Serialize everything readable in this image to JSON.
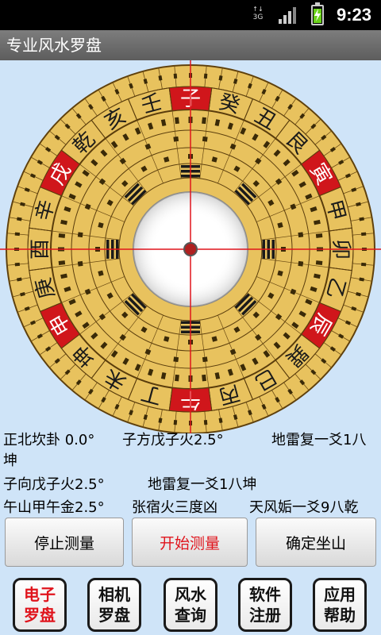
{
  "status_bar": {
    "time": "9:23",
    "network_label": "3G",
    "battery_color": "#6ad11a"
  },
  "app_title": "专业风水罗盘",
  "compass": {
    "ring_outer_labels": [
      "子",
      "癸",
      "丑",
      "艮",
      "寅",
      "甲",
      "卯",
      "乙",
      "辰",
      "巽",
      "巳",
      "丙",
      "午",
      "丁",
      "未",
      "坤",
      "申",
      "庚",
      "酉",
      "辛",
      "戌",
      "乾",
      "亥",
      "壬"
    ],
    "center_color": "#ffffff",
    "face_color": "#e8c25e",
    "red_accent": "#d0161b"
  },
  "readings": {
    "line1_a": "正北坎卦  0.0°",
    "line1_b": "子方戊子火2.5°",
    "line1_c": "地雷复一爻1八",
    "line1_wrap": "坤",
    "line2_a": "子向戊子火2.5°",
    "line2_b": "地雷复一爻1八坤",
    "line3_a": "午山甲午金2.5°",
    "line3_b": "张宿火三度凶",
    "line3_c": "天风姤一爻9八乾"
  },
  "buttons": {
    "stop": "停止测量",
    "start": "开始测量",
    "confirm": "确定坐山"
  },
  "tabs": [
    {
      "line1": "电子",
      "line2": "罗盘"
    },
    {
      "line1": "相机",
      "line2": "罗盘"
    },
    {
      "line1": "风水",
      "line2": "查询"
    },
    {
      "line1": "软件",
      "line2": "注册"
    },
    {
      "line1": "应用",
      "line2": "帮助"
    }
  ]
}
